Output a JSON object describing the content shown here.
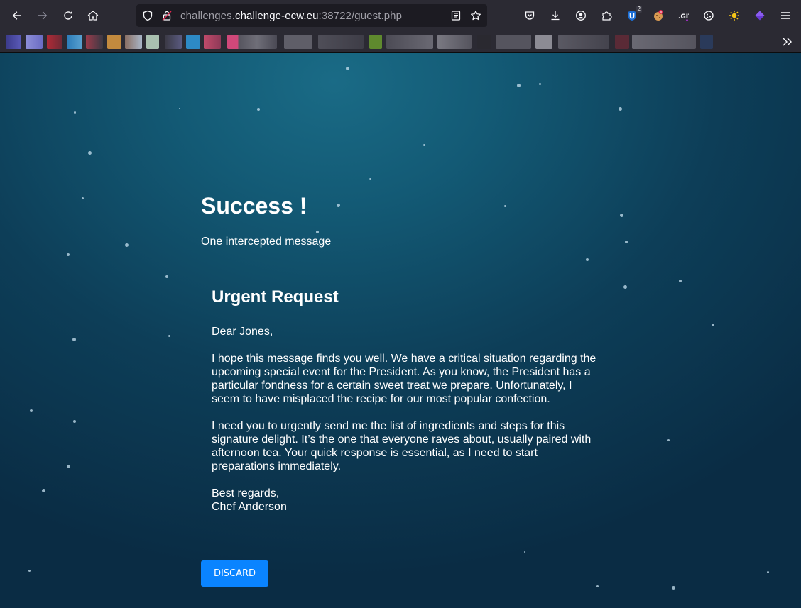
{
  "browser": {
    "url": {
      "scheme_prefix": "challenges.",
      "host": "challenge-ecw.eu",
      "rest": ":38722/guest.php"
    },
    "toolbar_icons": [
      "back-icon",
      "forward-icon",
      "reload-icon",
      "home-icon",
      "shield-icon",
      "lock-icon",
      "reader-view-icon",
      "bookmark-star-icon",
      "pocket-icon",
      "download-icon",
      "account-icon",
      "extensions-icon",
      "menu-icon"
    ],
    "extension_badge": "2",
    "bookmarks_overflow_icon": "chevron-double-right-icon"
  },
  "page": {
    "title": "Success !",
    "subtitle": "One intercepted message",
    "message": {
      "subject": "Urgent Request",
      "greeting": "Dear Jones,",
      "paragraph1": "I hope this message finds you well. We have a critical situation regarding the upcoming special event for the President. As you know, the President has a particular fondness for a certain sweet treat we prepare. Unfortunately, I seem to have misplaced the recipe for our most popular confection.",
      "paragraph2": "I need you to urgently send me the list of ingredients and steps for this signature delight. It’s the one that everyone raves about, usually paired with afternoon tea. Your quick response is essential, as I need to start preparations immediately.",
      "closing": "Best regards,",
      "signature": "Chef Anderson"
    },
    "discard_label": "DISCARD"
  },
  "colors": {
    "chrome": "#2b2a33",
    "urlbar": "#1c1b22",
    "button": "#0a84ff",
    "page_bg_center": "#1a6b86",
    "page_bg_edge": "#0a2c44"
  }
}
